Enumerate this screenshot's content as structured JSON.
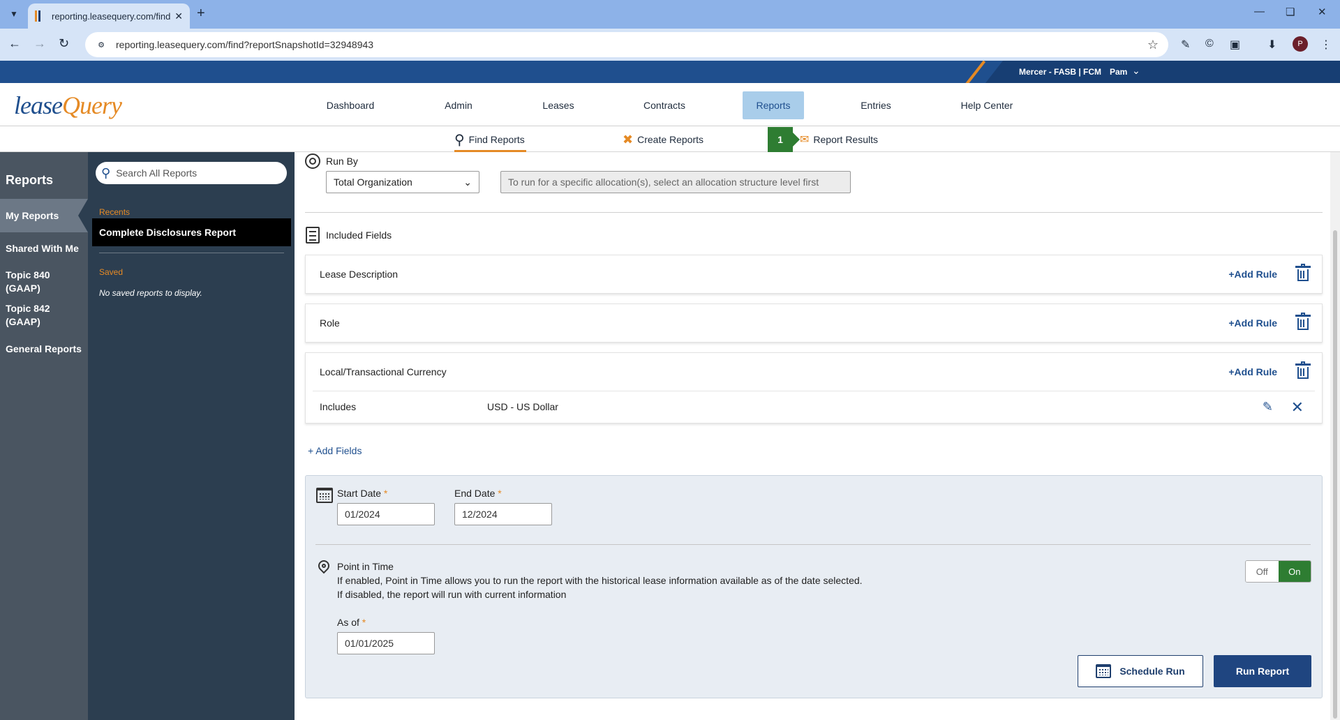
{
  "browser": {
    "tab_title": "reporting.leasequery.com/find?",
    "new_tab": "+",
    "url": "reporting.leasequery.com/find?reportSnapshotId=32948943",
    "profile_initial": "P"
  },
  "header": {
    "org": "Mercer - FASB | FCM",
    "user": "Pam"
  },
  "logo": {
    "part1": "lease",
    "part2": "Query"
  },
  "nav": {
    "items": [
      "Dashboard",
      "Admin",
      "Leases",
      "Contracts",
      "Reports",
      "Entries",
      "Help Center"
    ],
    "active": "Reports"
  },
  "subnav": {
    "find": "Find Reports",
    "create": "Create Reports",
    "step": "1",
    "results": "Report Results"
  },
  "leftrail": {
    "title": "Reports",
    "items": [
      "My Reports",
      "Shared With Me",
      "Topic 840 (GAAP)",
      "Topic 842 (GAAP)",
      "General Reports"
    ]
  },
  "panel": {
    "search_placeholder": "Search All Reports",
    "recents_label": "Recents",
    "recent_item": "Complete Disclosures Report",
    "saved_label": "Saved",
    "no_saved": "No saved reports to display."
  },
  "runby": {
    "label": "Run By",
    "selected": "Total Organization",
    "alloc_placeholder": "To run for a specific allocation(s), select an allocation structure level first"
  },
  "included": {
    "label": "Included Fields",
    "add_rule": "+Add Rule",
    "fields": [
      {
        "name": "Lease Description"
      },
      {
        "name": "Role"
      },
      {
        "name": "Local/Transactional Currency",
        "rule_key": "Includes",
        "rule_value": "USD - US Dollar"
      }
    ],
    "add_fields": "+ Add Fields"
  },
  "dates": {
    "start_label": "Start Date",
    "start_value": "01/2024",
    "end_label": "End Date",
    "end_value": "12/2024",
    "required": "*"
  },
  "pit": {
    "title": "Point in Time",
    "desc1": "If enabled, Point in Time allows you to run the report with the historical lease information available as of the date selected.",
    "desc2": "If disabled, the report will run with current information",
    "asof_label": "As of",
    "asof_value": "01/01/2025",
    "toggle_off": "Off",
    "toggle_on": "On",
    "state": "On"
  },
  "actions": {
    "schedule": "Schedule Run",
    "run": "Run Report"
  },
  "colors": {
    "brand_blue": "#1f4f8e",
    "brand_orange": "#e58a25",
    "success_green": "#2e7d32"
  }
}
